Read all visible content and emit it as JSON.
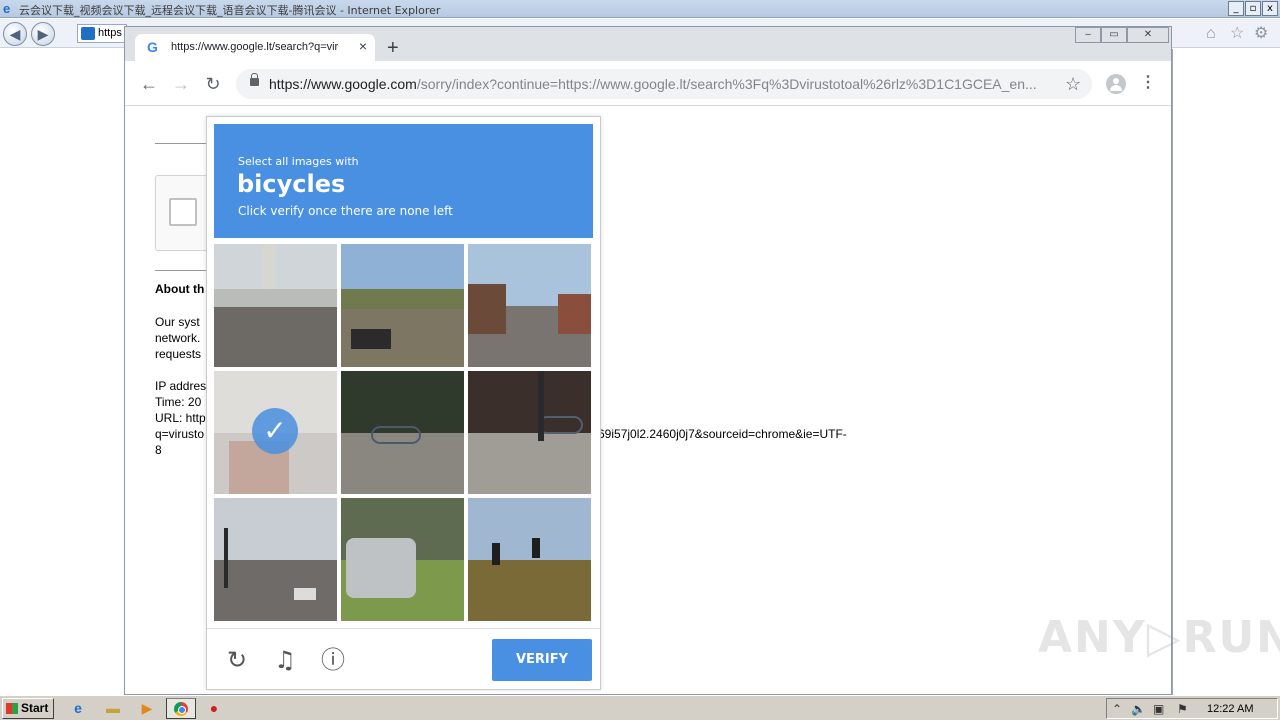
{
  "ie": {
    "title": "云会议下载_视频会议下载_远程会议下载_语音会议下载-腾讯会议 - Internet Explorer",
    "address": "https",
    "min_label": "_",
    "max_label": "▫",
    "close_label": "x"
  },
  "chrome": {
    "tab_title": "https://www.google.lt/search?q=vir",
    "tab_close": "×",
    "new_tab": "+",
    "url_host": "https://www.google.com",
    "url_rest": "/sorry/index?continue=https://www.google.lt/search%3Fq%3Dvirustotoal%26rlz%3D1C1GCEA_en...",
    "win_min": "‒",
    "win_restore": "▭",
    "win_close": "✕"
  },
  "page": {
    "about_title": "About th",
    "line1": "Our syst",
    "line2": "network.",
    "line3": "requests",
    "line4": "IP addres",
    "line5": "Time: 20",
    "line6": "URL: http",
    "line7": "q=virusto",
    "line8": "8",
    "url_tail": "69i57j0l2.2460j0j7&sourceid=chrome&ie=UTF-"
  },
  "captcha": {
    "instruction_small": "Select all images with",
    "target_word": "bicycles",
    "instruction_sub": "Click verify once there are none left",
    "verify_label": "VERIFY",
    "check_mark": "✓",
    "selected_tile": 4
  },
  "watermark": "ANY▷RUN",
  "taskbar": {
    "start_label": "Start",
    "clock": "12:22 AM"
  },
  "colors": {
    "recaptcha_blue": "#4a90e2",
    "chrome_tabstrip": "#dee1e6",
    "taskbar": "#d4d0c8"
  }
}
